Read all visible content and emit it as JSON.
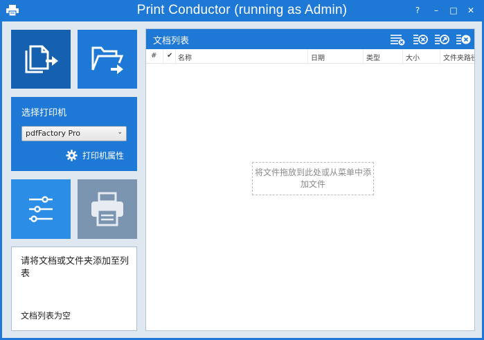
{
  "window": {
    "title": "Print Conductor (running as Admin)",
    "help": "?",
    "minimize": "–",
    "maximize": "□",
    "close": "✕"
  },
  "left": {
    "printer_section_label": "选择打印机",
    "printer_selected": "pdfFactory Pro",
    "printer_properties_label": "打印机属性",
    "status_message": "请将文档或文件夹添加至列表",
    "status_sub": "文档列表为空"
  },
  "list": {
    "title": "文档列表",
    "columns": [
      "#",
      "✔",
      "名称",
      "日期",
      "类型",
      "大小",
      "文件夹路径"
    ],
    "drop_hint": "将文件拖放到此处或从菜单中添加文件"
  },
  "colors": {
    "accent": "#1e78d6",
    "accent_dark": "#1660b0",
    "print_disabled": "#7b95b0",
    "background": "#dfe7f1"
  }
}
